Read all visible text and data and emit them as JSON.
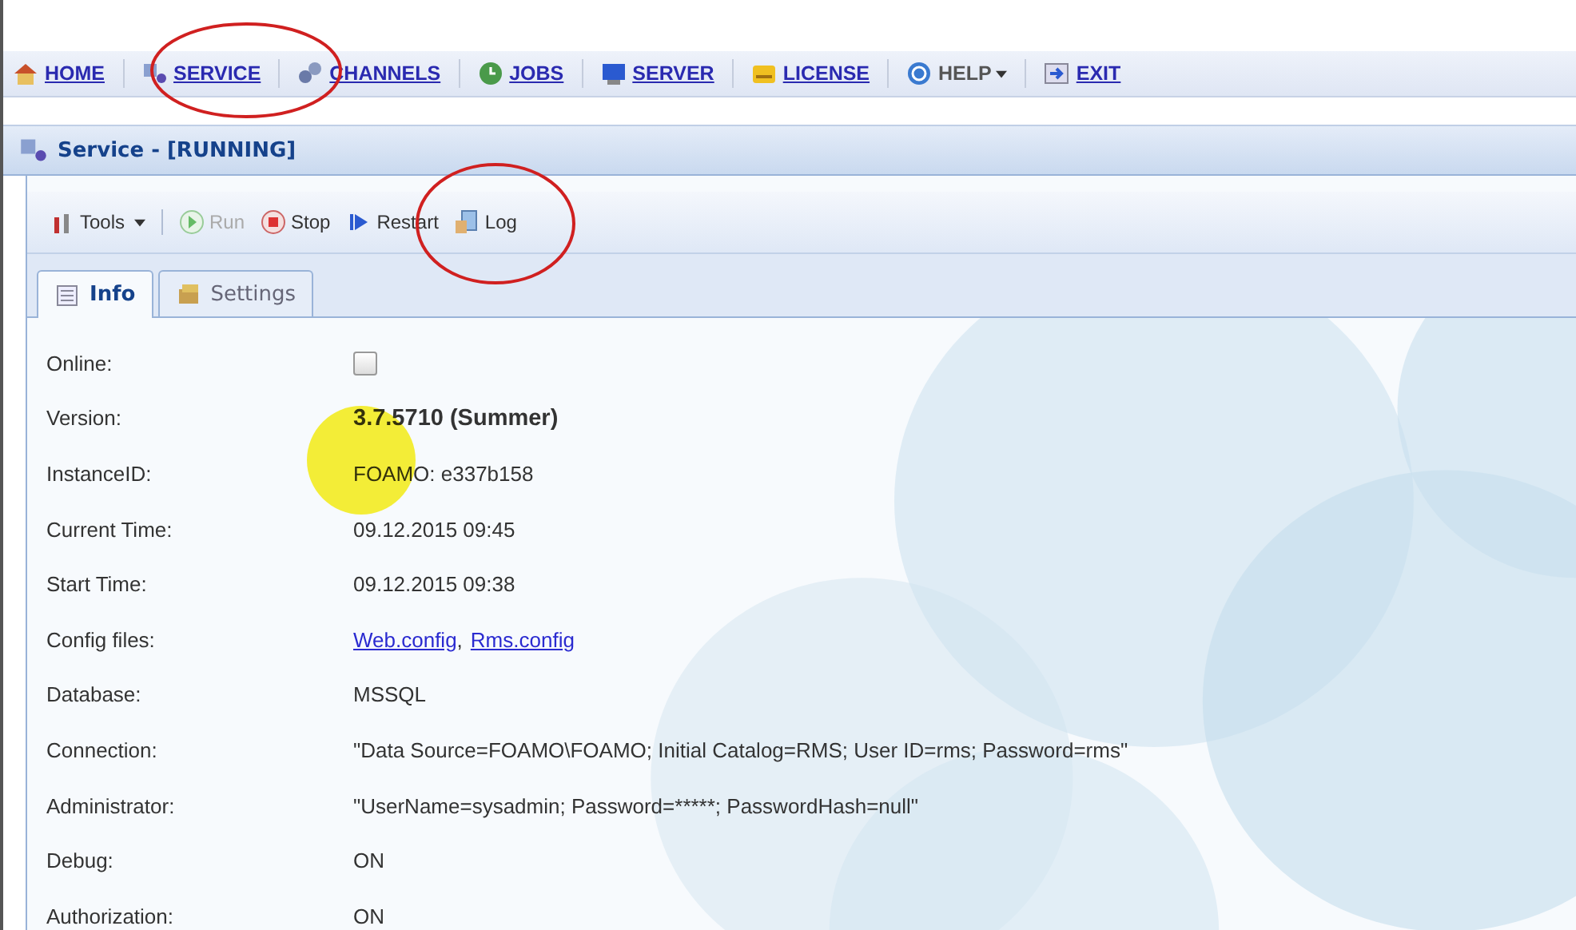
{
  "nav": [
    {
      "label": "HOME",
      "kind": "link"
    },
    {
      "label": "SERVICE",
      "kind": "link"
    },
    {
      "label": "CHANNELS",
      "kind": "link"
    },
    {
      "label": "JOBS",
      "kind": "link"
    },
    {
      "label": "SERVER",
      "kind": "link"
    },
    {
      "label": "LICENSE",
      "kind": "link"
    },
    {
      "label": "HELP",
      "kind": "menu"
    },
    {
      "label": "EXIT",
      "kind": "link"
    }
  ],
  "panel": {
    "title": "Service - [RUNNING]"
  },
  "toolbar": [
    {
      "label": "Tools",
      "disabled": false,
      "dropdown": true
    },
    {
      "label": "Run",
      "disabled": true,
      "dropdown": false
    },
    {
      "label": "Stop",
      "disabled": false,
      "dropdown": false
    },
    {
      "label": "Restart",
      "disabled": false,
      "dropdown": false
    },
    {
      "label": "Log",
      "disabled": false,
      "dropdown": false
    }
  ],
  "tabs": [
    {
      "label": "Info",
      "selected": true
    },
    {
      "label": "Settings",
      "selected": false
    }
  ],
  "info": [
    {
      "label": "Online:",
      "kind": "checkbox",
      "checked": false
    },
    {
      "label": "Version:",
      "kind": "bold",
      "value": "3.7.5710 (Summer)"
    },
    {
      "label": "InstanceID:",
      "kind": "text",
      "value": "FOAMO: e337b158"
    },
    {
      "label": "Current Time:",
      "kind": "text",
      "value": "09.12.2015 09:45"
    },
    {
      "label": "Start Time:",
      "kind": "text",
      "value": "09.12.2015 09:38"
    },
    {
      "label": "Config files:",
      "kind": "links",
      "links": [
        "Web.config",
        "Rms.config"
      ],
      "separator": ","
    },
    {
      "label": "Database:",
      "kind": "text",
      "value": "MSSQL"
    },
    {
      "label": "Connection:",
      "kind": "text",
      "value": "\"Data Source=FOAMO\\FOAMO; Initial Catalog=RMS; User ID=rms; Password=rms\""
    },
    {
      "label": "Administrator:",
      "kind": "text",
      "value": "\"UserName=sysadmin; Password=*****; PasswordHash=null\""
    },
    {
      "label": "Debug:",
      "kind": "text",
      "value": "ON"
    },
    {
      "label": "Authorization:",
      "kind": "text",
      "value": "ON"
    }
  ]
}
